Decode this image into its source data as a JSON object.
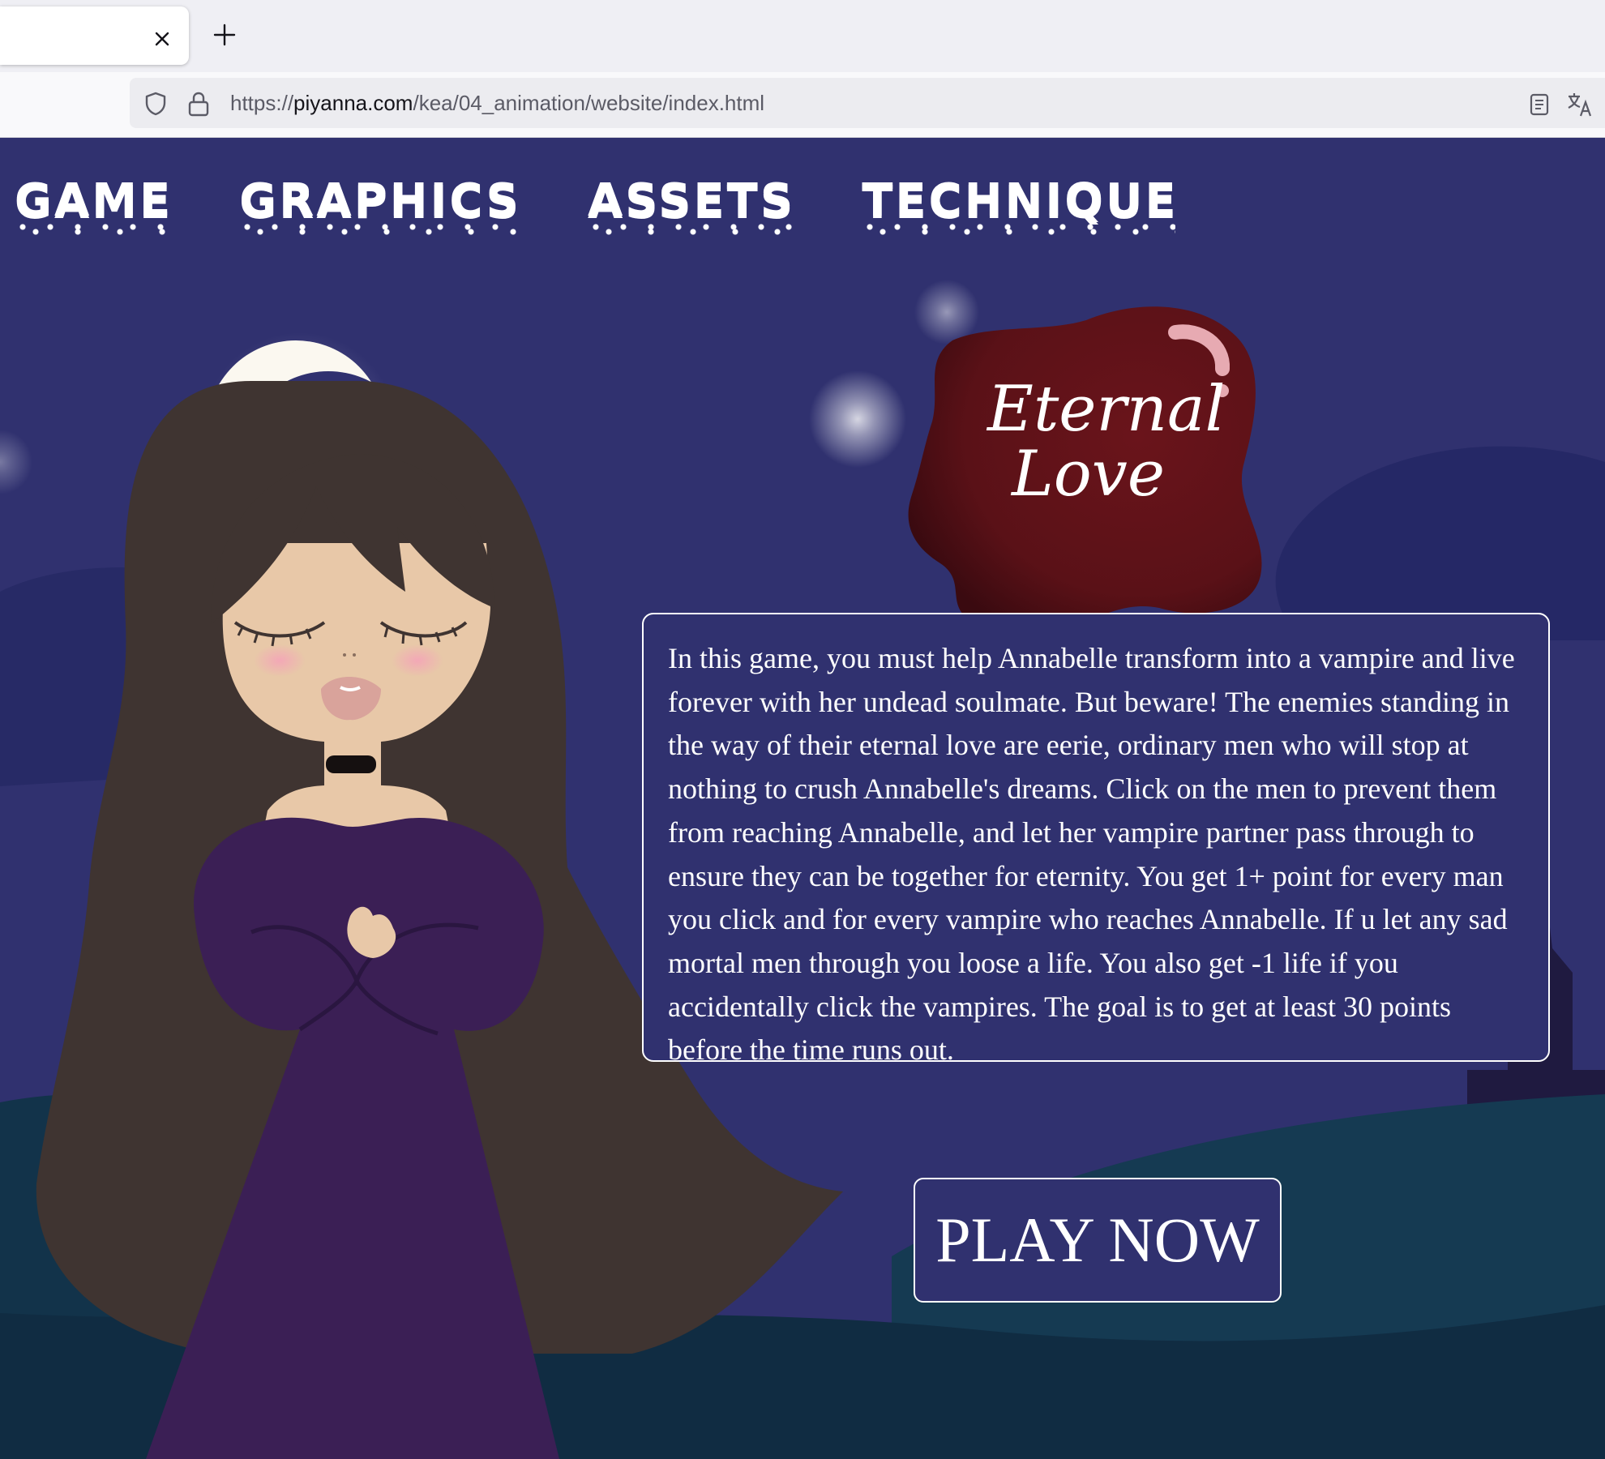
{
  "browser": {
    "close_tab_icon": "close-icon",
    "new_tab_icon": "plus-icon",
    "url_scheme": "https://",
    "url_host": "piyanna.com",
    "url_path": "/kea/04_animation/website/index.html",
    "security_icon": "shield-icon",
    "lock_icon": "lock-icon",
    "reader_icon": "reader-view-icon",
    "translate_icon": "translate-icon"
  },
  "nav": {
    "items": [
      {
        "label": "GAME"
      },
      {
        "label": "GRAPHICS"
      },
      {
        "label": "ASSETS"
      },
      {
        "label": "TECHNIQUE"
      }
    ]
  },
  "logo": {
    "line1": "Eternal",
    "line2": "Love",
    "color": "#5a1117"
  },
  "main": {
    "description": "In this game, you must help Annabelle transform into a vampire and live forever with her undead soulmate. But beware! The enemies standing in the way of their eternal love are eerie, ordinary men who will stop at nothing to crush Annabelle's dreams. Click on the men to prevent them from reaching Annabelle, and let her vampire partner pass through to ensure they can be together for eternity. You get 1+ point for every man you click and for every vampire who reaches Annabelle. If u let any sad mortal men through you loose a life. You also get -1 life if you accidentally click the vampires. The goal is to get at least 30 points before the time runs out.",
    "play_label": "PLAY NOW"
  },
  "colors": {
    "sky": "#30316f",
    "hills": "#1c2a4a",
    "dress": "#3b1f55",
    "hair": "#3f3431",
    "skin": "#e8c8a8"
  }
}
